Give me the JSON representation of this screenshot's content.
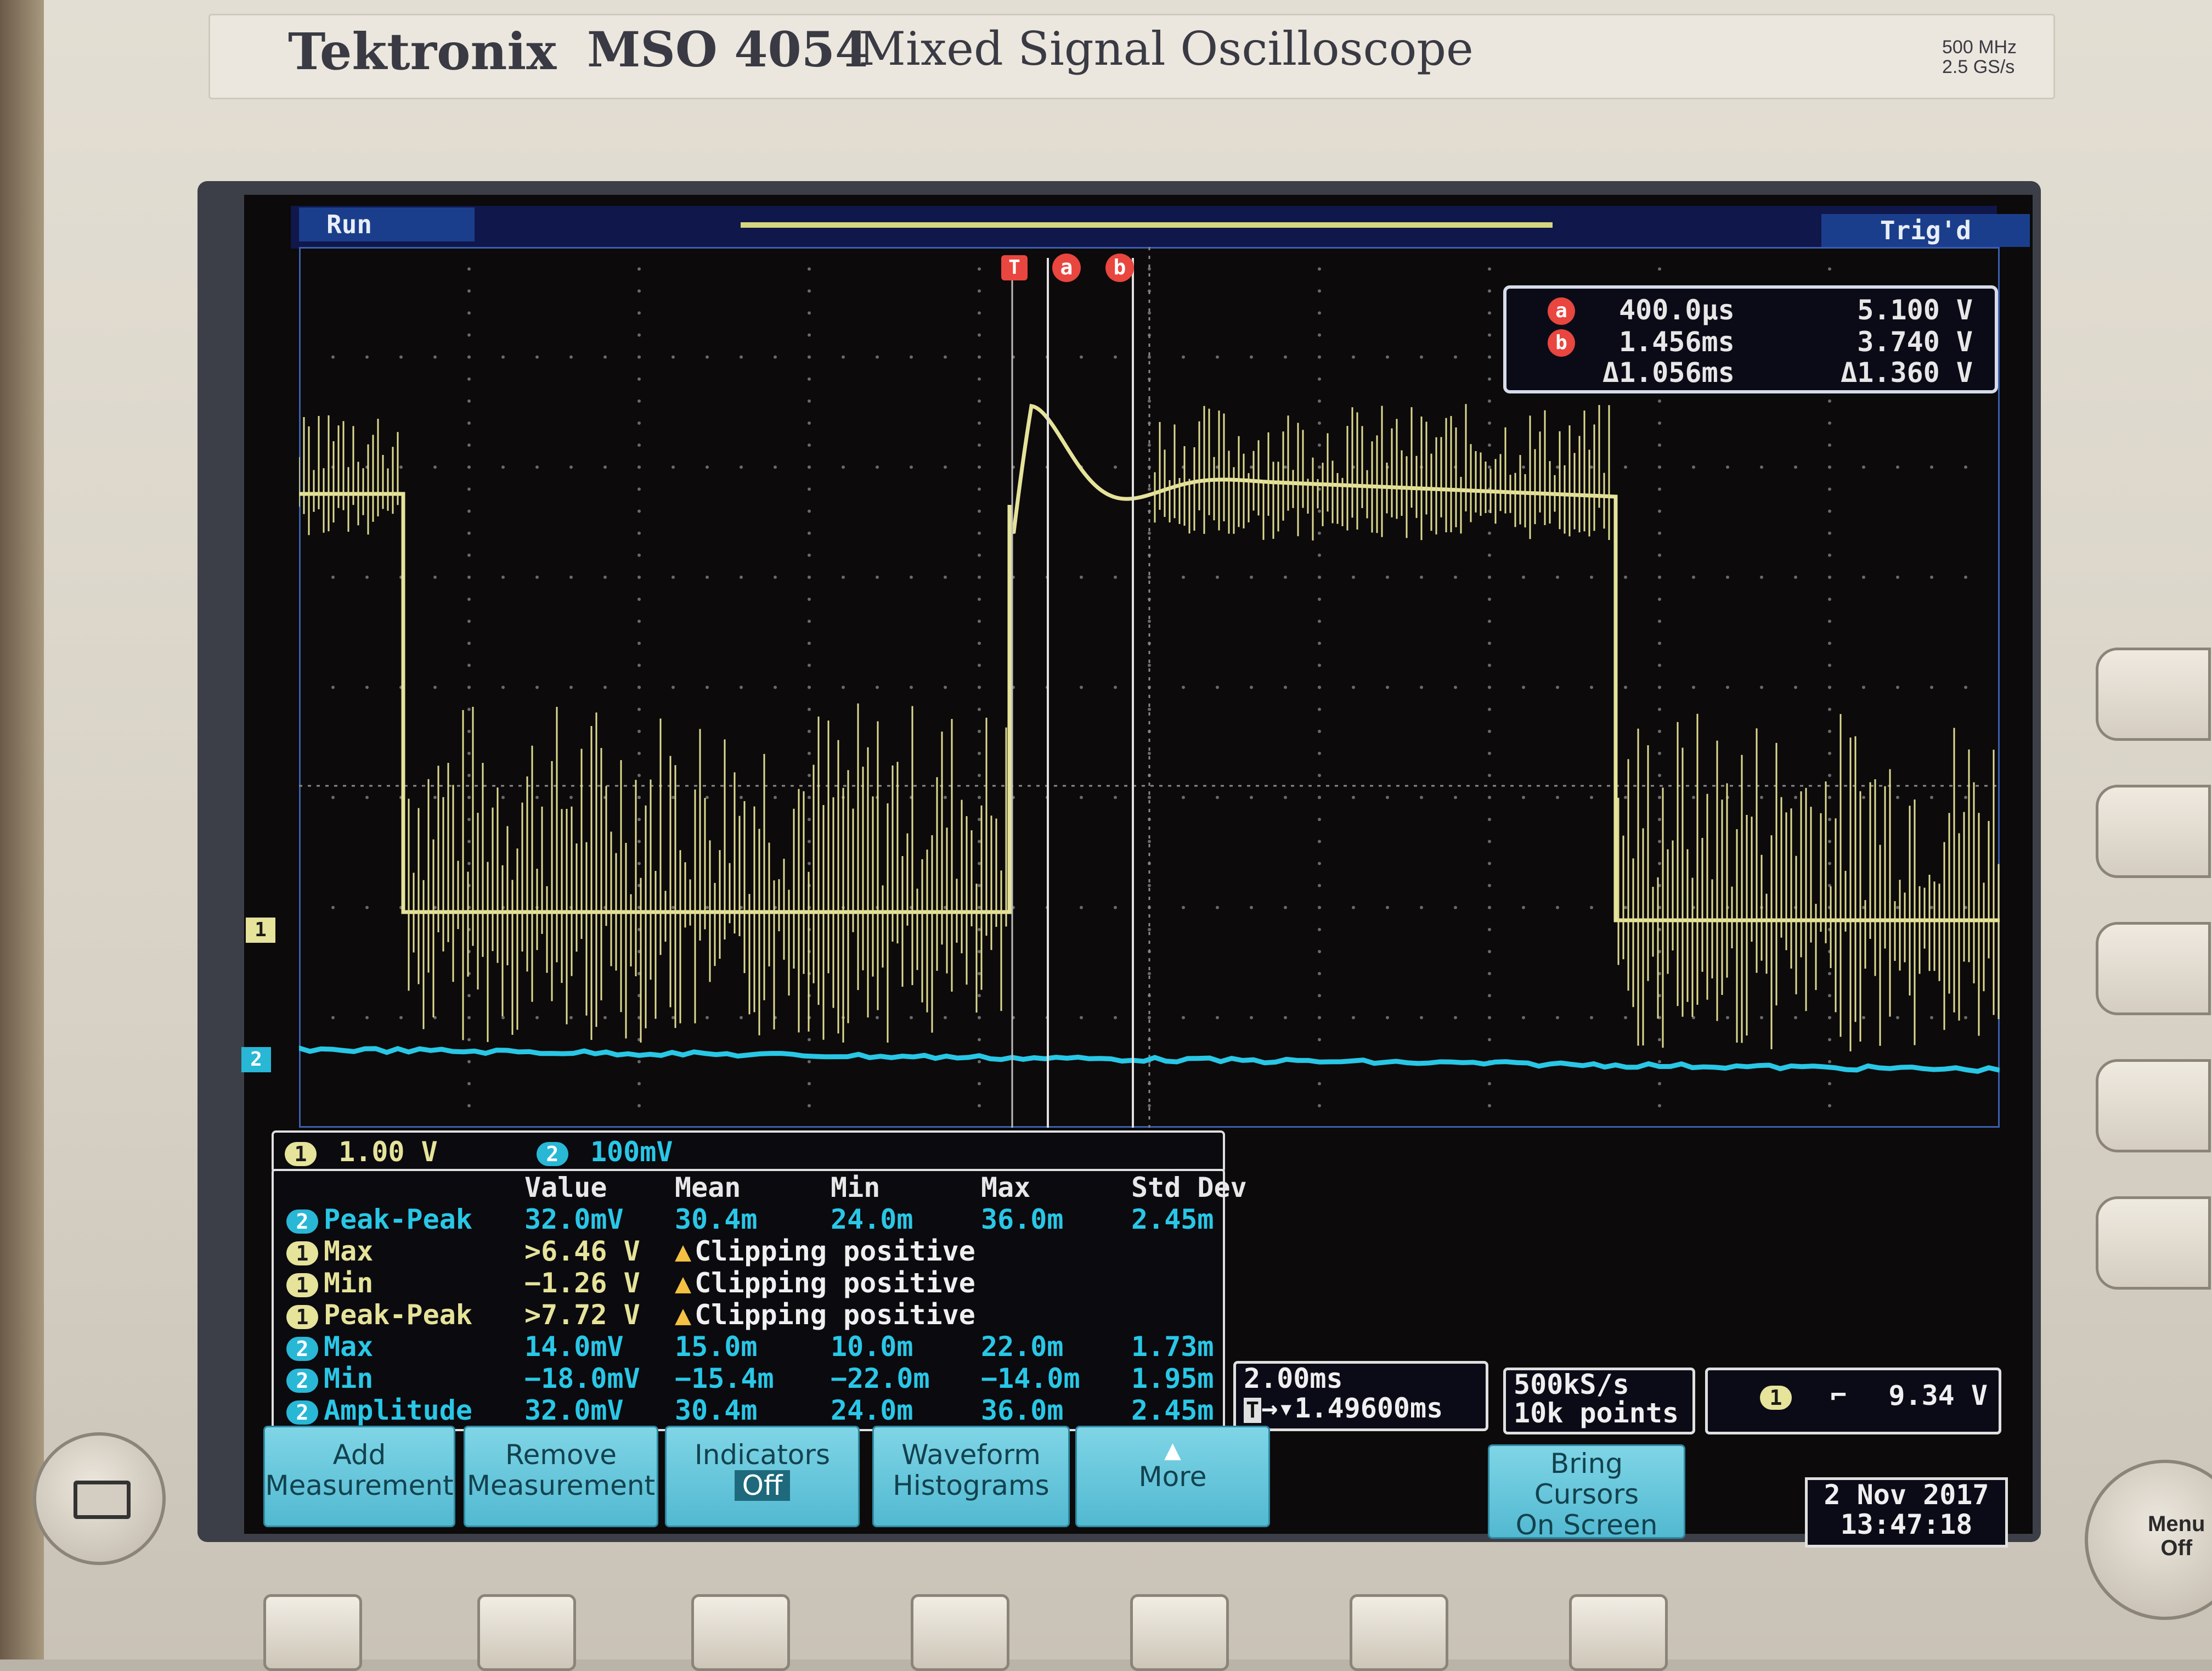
{
  "instrument": {
    "brand": "Tektronix",
    "model": "MSO 4054",
    "description": "Mixed Signal Oscilloscope",
    "bandwidth": "500 MHz",
    "sample_rate_spec": "2.5 GS/s"
  },
  "status": {
    "run_state": "Run",
    "trigger_state": "Trig'd"
  },
  "markers": {
    "trigger": "T",
    "cursor_a": "a",
    "cursor_b": "b",
    "ch1": "1",
    "ch2": "2"
  },
  "cursors": {
    "a_time": "400.0µs",
    "a_value": "5.100 V",
    "b_time": "1.456ms",
    "b_value": "3.740 V",
    "delta_time": "Δ1.056ms",
    "delta_value": "Δ1.360 V"
  },
  "channel_scales": {
    "ch1_scale": "1.00 V",
    "ch2_scale": "100mV"
  },
  "measurements": {
    "headers": [
      "Value",
      "Mean",
      "Min",
      "Max",
      "Std Dev"
    ],
    "rows": [
      {
        "ch": "2",
        "name": "Peak-Peak",
        "value": "32.0mV",
        "mean": "30.4m",
        "min": "24.0m",
        "max": "36.0m",
        "std": "2.45m"
      },
      {
        "ch": "1",
        "name": "Max",
        "value": ">6.46 V",
        "note": "Clipping positive"
      },
      {
        "ch": "1",
        "name": "Min",
        "value": "−1.26 V",
        "note": "Clipping positive"
      },
      {
        "ch": "1",
        "name": "Peak-Peak",
        "value": ">7.72 V",
        "note": "Clipping positive"
      },
      {
        "ch": "2",
        "name": "Max",
        "value": "14.0mV",
        "mean": "15.0m",
        "min": "10.0m",
        "max": "22.0m",
        "std": "1.73m"
      },
      {
        "ch": "2",
        "name": "Min",
        "value": "−18.0mV",
        "mean": "−15.4m",
        "min": "−22.0m",
        "max": "−14.0m",
        "std": "1.95m"
      },
      {
        "ch": "2",
        "name": "Amplitude",
        "value": "32.0mV",
        "mean": "30.4m",
        "min": "24.0m",
        "max": "36.0m",
        "std": "2.45m"
      }
    ]
  },
  "horizontal": {
    "time_per_div": "2.00ms",
    "trigger_position": "1.49600ms",
    "trigger_marker": "T"
  },
  "acquisition": {
    "sample_rate": "500kS/s",
    "record_length": "10k points"
  },
  "trigger": {
    "source": "1",
    "slope_symbol": "⌐",
    "level": "9.34 V"
  },
  "softkeys": {
    "add_measurement_line1": "Add",
    "add_measurement_line2": "Measurement",
    "remove_measurement_line1": "Remove",
    "remove_measurement_line2": "Measurement",
    "indicators_line1": "Indicators",
    "indicators_line2": "Off",
    "waveform_histograms_line1": "Waveform",
    "waveform_histograms_line2": "Histograms",
    "more": "More",
    "bring_cursors_line1": "Bring",
    "bring_cursors_line2": "Cursors",
    "bring_cursors_line3": "On Screen"
  },
  "datetime": {
    "date": "2 Nov 2017",
    "time": "13:47:18"
  },
  "menu_off": {
    "line1": "Menu",
    "line2": "Off"
  },
  "colors": {
    "ch1": "#e6e39a",
    "ch2": "#29c7e6",
    "cursor": "#e8463f",
    "softkey": "#6ccbe0"
  }
}
